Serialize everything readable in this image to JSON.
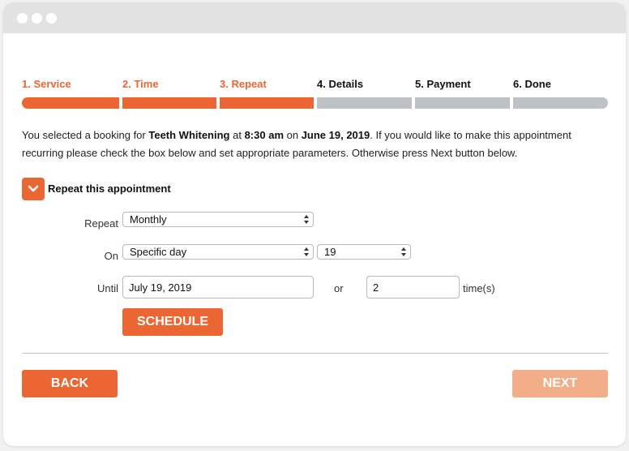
{
  "window": {
    "title_dots": [
      "dot",
      "dot",
      "dot"
    ]
  },
  "steps": [
    {
      "label": "1. Service",
      "active": true
    },
    {
      "label": "2. Time",
      "active": true
    },
    {
      "label": "3. Repeat",
      "active": true
    },
    {
      "label": "4. Details",
      "active": false
    },
    {
      "label": "5. Payment",
      "active": false
    },
    {
      "label": "6. Done",
      "active": false
    }
  ],
  "intro": {
    "part1": "You selected a booking for ",
    "service": "Teeth Whitening",
    "part2": " at ",
    "time": "8:30 am",
    "part3": " on ",
    "date": "June 19, 2019",
    "part4": ". If you would like to make this appointment recurring please check the box below and set appropriate parameters. Otherwise press Next button below."
  },
  "repeat_checkbox": {
    "label": "Repeat this appointment",
    "checked": true,
    "icon": "chevron-down-icon"
  },
  "form": {
    "repeat_label": "Repeat",
    "repeat_value": "Monthly",
    "on_label": "On",
    "on_value": "Specific day",
    "day_value": "19",
    "until_label": "Until",
    "until_value": "July 19, 2019",
    "or_label": "or",
    "times_value": "2",
    "times_label": "time(s)",
    "schedule_button": "SCHEDULE"
  },
  "footer": {
    "back_button": "BACK",
    "next_button": "NEXT"
  },
  "colors": {
    "accent": "#ec6634",
    "accent_disabled": "#f2ae88",
    "inactive_step": "#bec2c6"
  }
}
